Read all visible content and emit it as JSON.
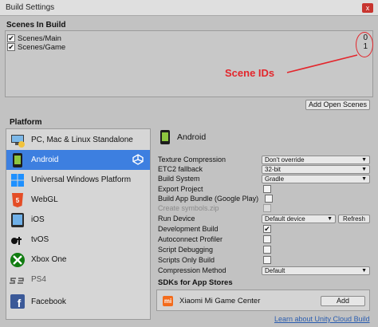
{
  "window": {
    "title": "Build Settings",
    "close_label": "x"
  },
  "scenes": {
    "header": "Scenes In Build",
    "items": [
      {
        "name": "Scenes/Main",
        "checked": true,
        "id": "0"
      },
      {
        "name": "Scenes/Game",
        "checked": true,
        "id": "1"
      }
    ],
    "annotation": "Scene IDs",
    "annotation_color": "#e3262c",
    "add_open_scenes_label": "Add Open Scenes"
  },
  "platform": {
    "header": "Platform",
    "selected": "Android",
    "selected_color": "#3d7fe0",
    "items": [
      {
        "label": "PC, Mac & Linux Standalone",
        "icon": "standalone-icon"
      },
      {
        "label": "Android",
        "icon": "android-icon"
      },
      {
        "label": "Universal Windows Platform",
        "icon": "windows-icon"
      },
      {
        "label": "WebGL",
        "icon": "html5-icon"
      },
      {
        "label": "iOS",
        "icon": "ios-icon"
      },
      {
        "label": "tvOS",
        "icon": "tvos-icon"
      },
      {
        "label": "Xbox One",
        "icon": "xbox-icon"
      },
      {
        "label": "PS4",
        "icon": "ps4-icon"
      },
      {
        "label": "Facebook",
        "icon": "facebook-icon"
      }
    ]
  },
  "android_settings": {
    "title": "Android",
    "texture_compression": {
      "label": "Texture Compression",
      "value": "Don't override"
    },
    "etc2_fallback": {
      "label": "ETC2 fallback",
      "value": "32-bit"
    },
    "build_system": {
      "label": "Build System",
      "value": "Gradle"
    },
    "export_project": {
      "label": "Export Project"
    },
    "build_app_bundle": {
      "label": "Build App Bundle (Google Play)"
    },
    "create_symbols": {
      "label": "Create symbols.zip"
    },
    "run_device": {
      "label": "Run Device",
      "value": "Default device",
      "refresh_label": "Refresh"
    },
    "development_build": {
      "label": "Development Build",
      "checked": true
    },
    "autoconnect_profiler": {
      "label": "Autoconnect Profiler"
    },
    "script_debugging": {
      "label": "Script Debugging"
    },
    "scripts_only_build": {
      "label": "Scripts Only Build"
    },
    "compression_method": {
      "label": "Compression Method",
      "value": "Default"
    }
  },
  "sdks": {
    "header": "SDKs for App Stores",
    "store_name": "Xiaomi Mi Game Center",
    "store_logo_text": "mi",
    "add_label": "Add"
  },
  "cloud_link": "Learn about Unity Cloud Build",
  "checkmark": "✔"
}
